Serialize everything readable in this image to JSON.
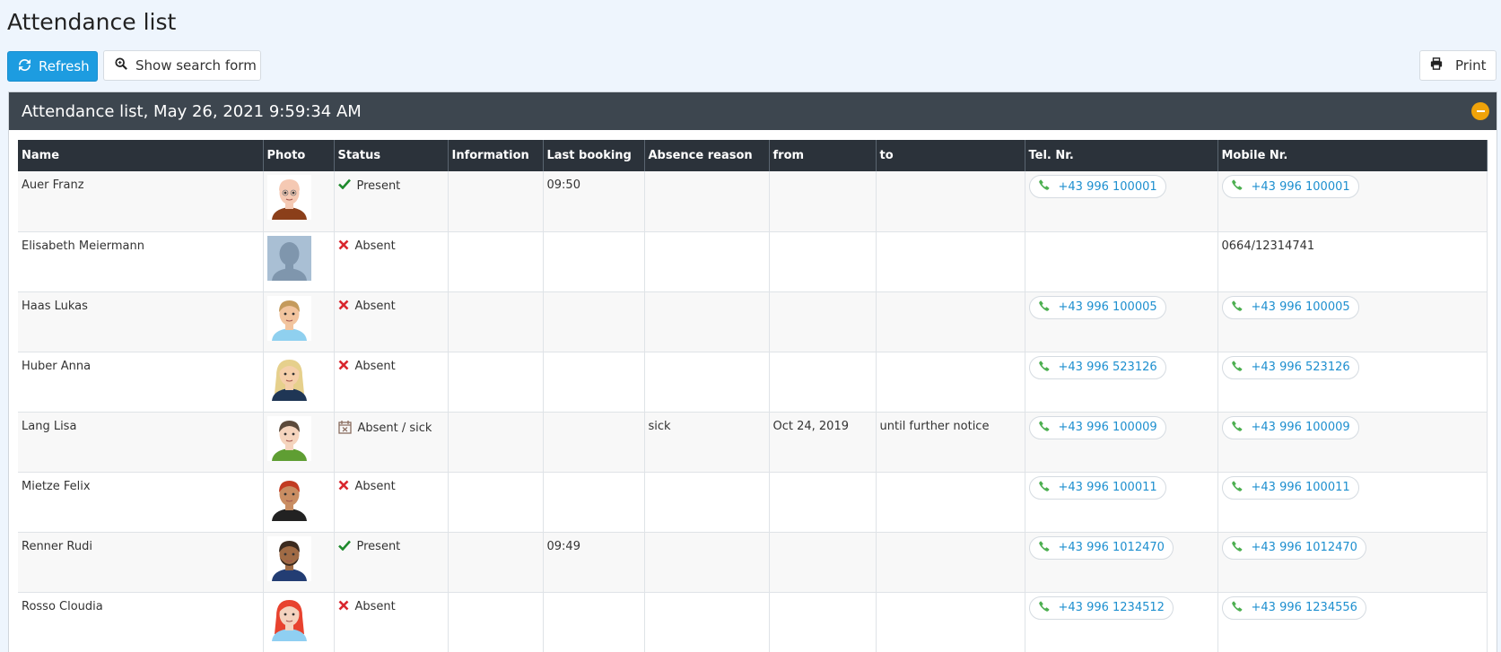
{
  "page": {
    "title": "Attendance list"
  },
  "toolbar": {
    "refresh_label": "Refresh",
    "search_label": "Show search form",
    "print_label": "Print"
  },
  "panel": {
    "title": "Attendance list, May 26, 2021 9:59:34 AM"
  },
  "table": {
    "columns": [
      "Name",
      "Photo",
      "Status",
      "Information",
      "Last booking",
      "Absence reason",
      "from",
      "to",
      "Tel. Nr.",
      "Mobile Nr."
    ],
    "rows": [
      {
        "name": "Auer Franz",
        "avatar": "bald-man-avatar",
        "status": "Present",
        "status_icon": "check-icon",
        "information": "",
        "last_booking": "09:50",
        "absence_reason": "",
        "from": "",
        "to": "",
        "tel": "+43 996 100001",
        "mobile": "+43 996 100001",
        "mobile_is_link": true
      },
      {
        "name": "Elisabeth Meiermann",
        "avatar": "silhouette-avatar",
        "status": "Absent",
        "status_icon": "cross-icon",
        "information": "",
        "last_booking": "",
        "absence_reason": "",
        "from": "",
        "to": "",
        "tel": "",
        "mobile": "0664/12314741",
        "mobile_is_link": false
      },
      {
        "name": "Haas Lukas",
        "avatar": "blond-man-avatar",
        "status": "Absent",
        "status_icon": "cross-icon",
        "information": "",
        "last_booking": "",
        "absence_reason": "",
        "from": "",
        "to": "",
        "tel": "+43 996 100005",
        "mobile": "+43 996 100005",
        "mobile_is_link": true
      },
      {
        "name": "Huber Anna",
        "avatar": "blonde-woman-avatar",
        "status": "Absent",
        "status_icon": "cross-icon",
        "information": "",
        "last_booking": "",
        "absence_reason": "",
        "from": "",
        "to": "",
        "tel": "+43 996 523126",
        "mobile": "+43 996 523126",
        "mobile_is_link": true
      },
      {
        "name": "Lang Lisa",
        "avatar": "brown-hair-woman-avatar",
        "status": "Absent / sick",
        "status_icon": "sick-calendar-icon",
        "information": "",
        "last_booking": "",
        "absence_reason": "sick",
        "from": "Oct 24, 2019",
        "to": "until further notice",
        "tel": "+43 996 100009",
        "mobile": "+43 996 100009",
        "mobile_is_link": true
      },
      {
        "name": "Mietze Felix",
        "avatar": "red-hair-man-avatar",
        "status": "Absent",
        "status_icon": "cross-icon",
        "information": "",
        "last_booking": "",
        "absence_reason": "",
        "from": "",
        "to": "",
        "tel": "+43 996 100011",
        "mobile": "+43 996 100011",
        "mobile_is_link": true
      },
      {
        "name": "Renner Rudi",
        "avatar": "bearded-man-avatar",
        "status": "Present",
        "status_icon": "check-icon",
        "information": "",
        "last_booking": "09:49",
        "absence_reason": "",
        "from": "",
        "to": "",
        "tel": "+43 996 1012470",
        "mobile": "+43 996 1012470",
        "mobile_is_link": true
      },
      {
        "name": "Rosso Cloudia",
        "avatar": "red-hair-woman-avatar",
        "status": "Absent",
        "status_icon": "cross-icon",
        "information": "",
        "last_booking": "",
        "absence_reason": "",
        "from": "",
        "to": "",
        "tel": "+43 996 1234512",
        "mobile": "+43 996 1234556",
        "mobile_is_link": true
      }
    ]
  },
  "colors": {
    "accent": "#1d9ce0",
    "present": "#1e8a2c",
    "absent": "#d9272e",
    "sick": "#8a6d60",
    "phone_icon": "#4caf50",
    "phone_text": "#1d8fcf",
    "panel_header": "#3d464f",
    "table_header": "#2b323a",
    "collapse": "#f0a30a"
  }
}
